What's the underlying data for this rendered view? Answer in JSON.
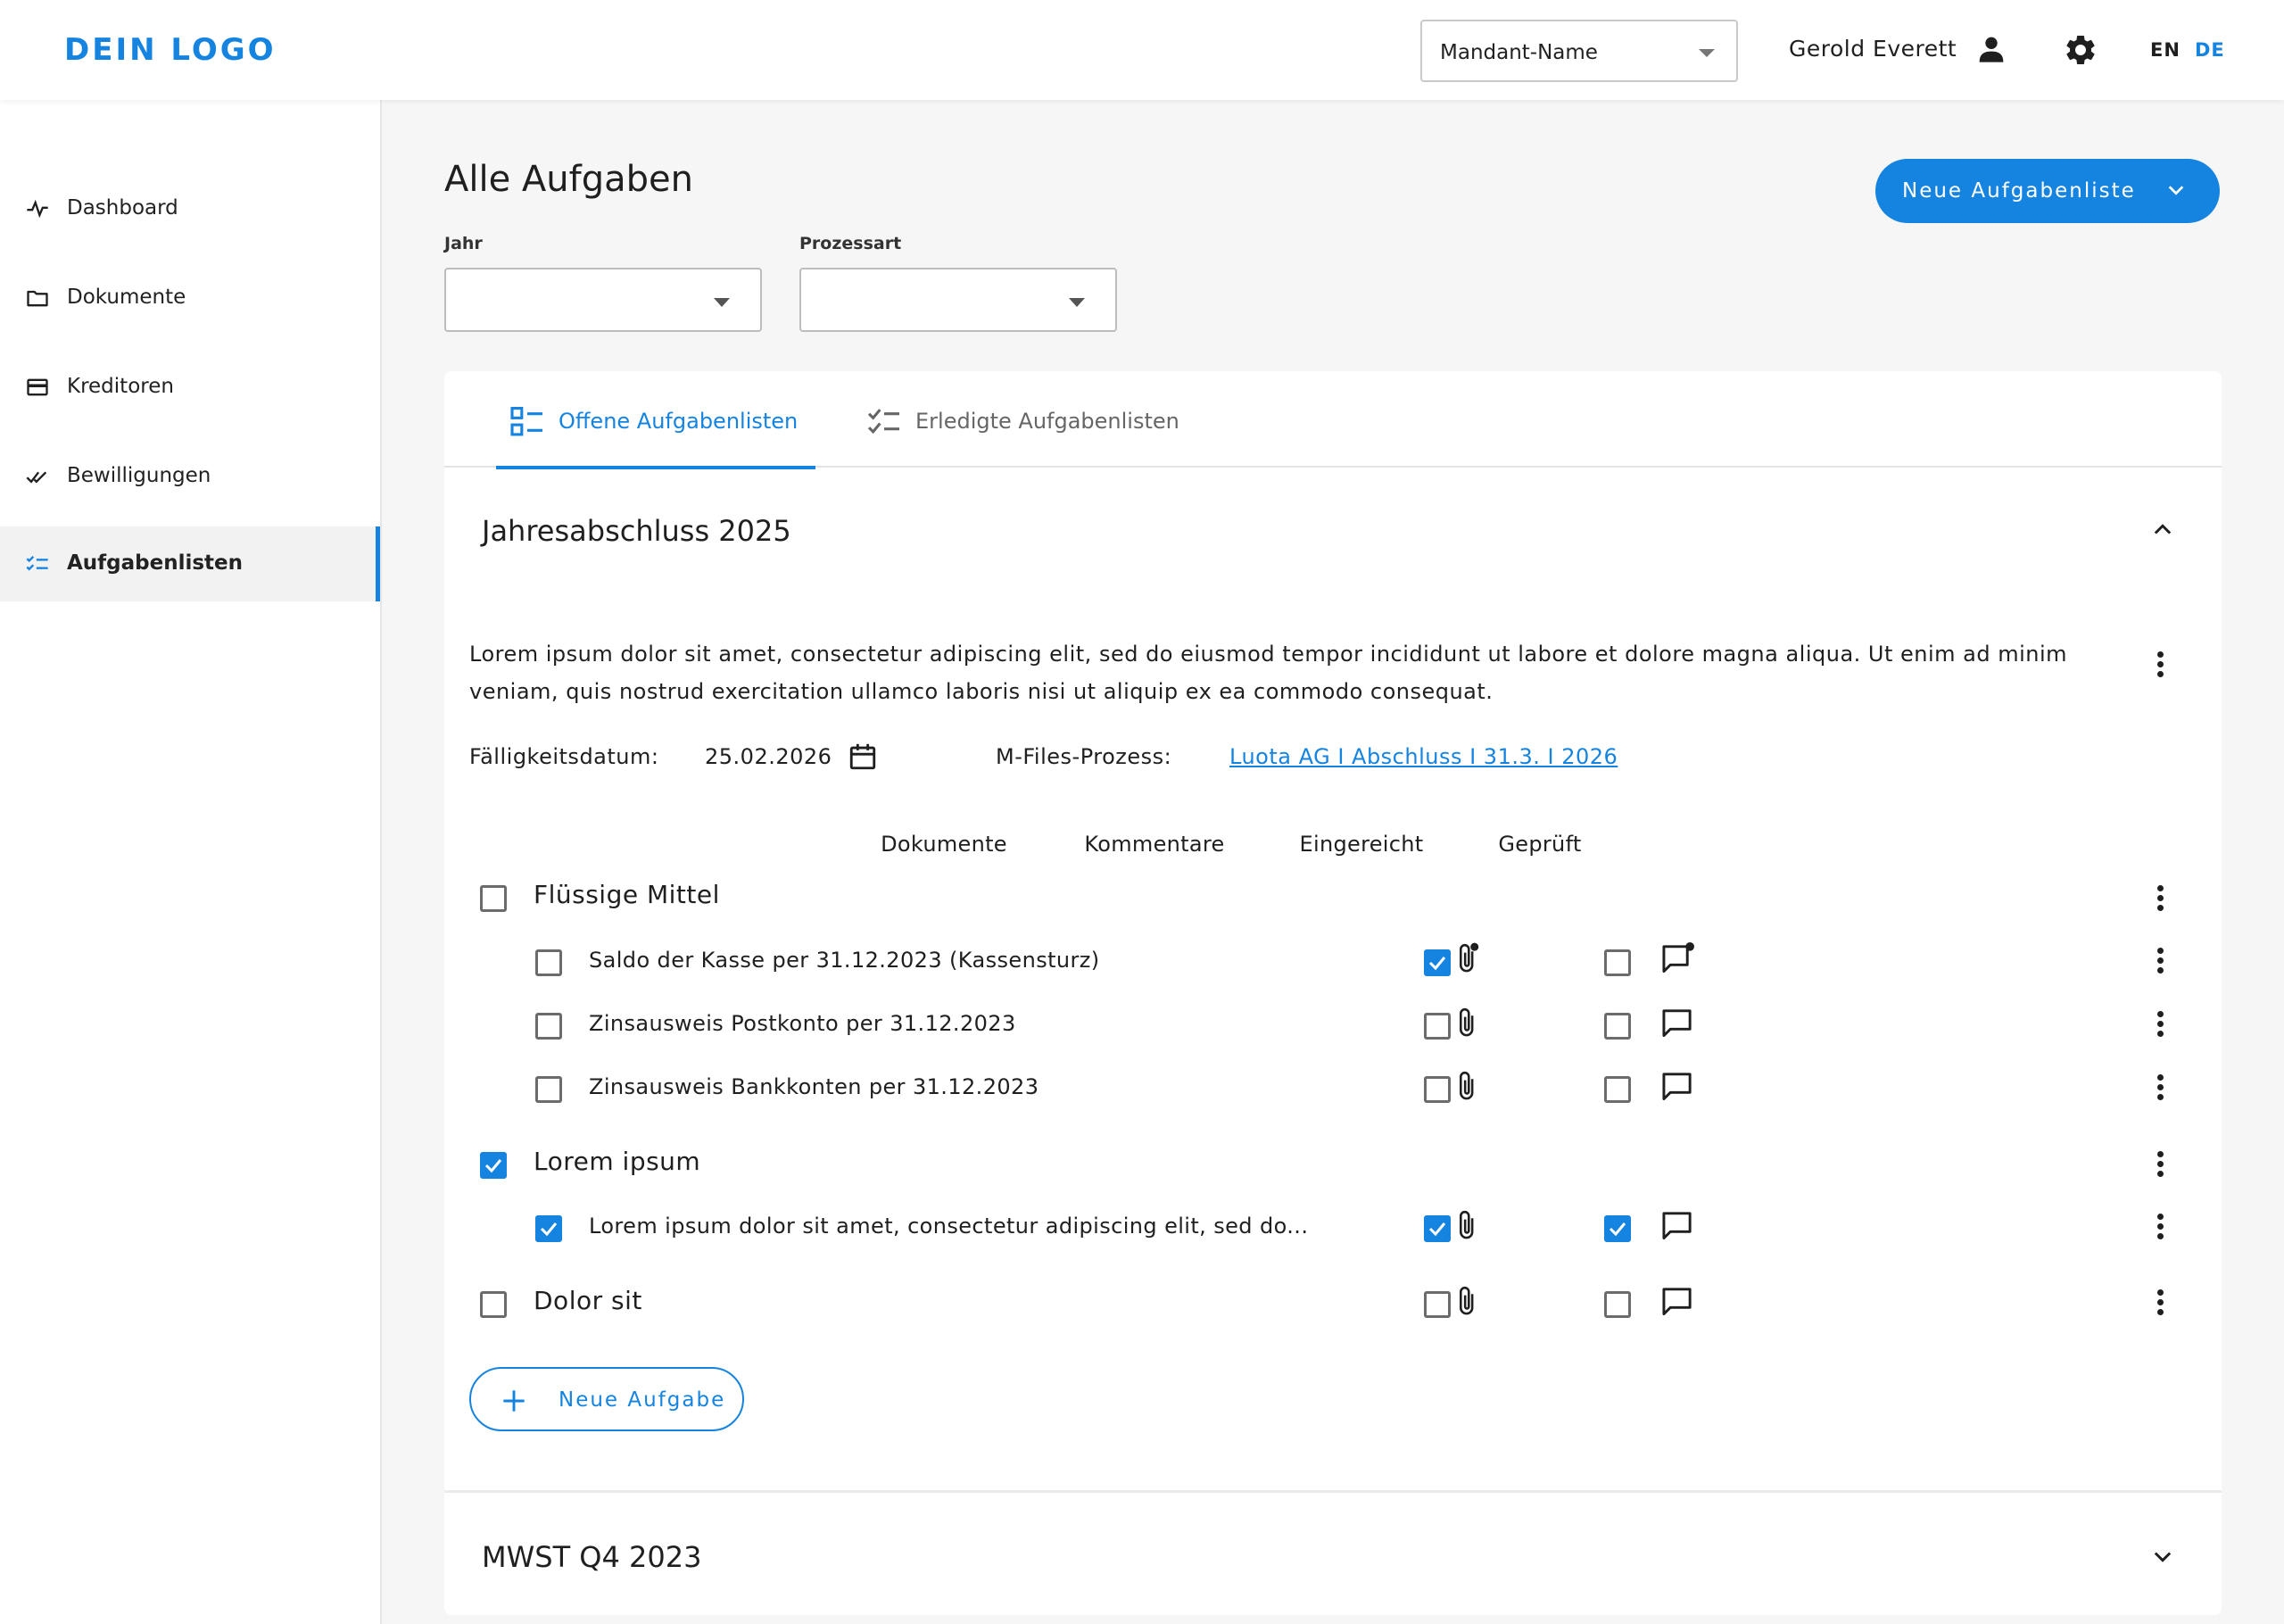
{
  "header": {
    "logo": "DEIN LOGO",
    "tenant_value": "Mandant-Name",
    "user_name": "Gerold Everett",
    "lang_en": "EN",
    "lang_de": "DE"
  },
  "sidebar": {
    "items": [
      {
        "label": "Dashboard",
        "icon": "activity-icon"
      },
      {
        "label": "Dokumente",
        "icon": "folder-icon"
      },
      {
        "label": "Kreditoren",
        "icon": "credit-card-icon"
      },
      {
        "label": "Bewilligungen",
        "icon": "double-check-icon"
      },
      {
        "label": "Aufgabenlisten",
        "icon": "checklist-icon",
        "active": true
      }
    ]
  },
  "main": {
    "title": "Alle Aufgaben",
    "new_list_label": "Neue Aufgabenliste",
    "filters": {
      "year_label": "Jahr",
      "year_value": "",
      "process_label": "Prozessart",
      "process_value": ""
    },
    "tabs": [
      {
        "label": "Offene Aufgabenlisten",
        "active": true
      },
      {
        "label": "Erledigte Aufgabenlisten",
        "active": false
      }
    ],
    "lists": [
      {
        "title": "Jahresabschluss 2025",
        "expanded": true,
        "description": "Lorem ipsum dolor sit amet, consectetur adipiscing elit, sed do eiusmod tempor incididunt ut labore et dolore magna aliqua. Ut enim ad minim veniam, quis nostrud exercitation ullamco laboris nisi ut aliquip ex ea commodo consequat.",
        "due_label": "Fälligkeitsdatum:",
        "due_value": "25.02.2026",
        "mfiles_label": "M-Files-Prozess:",
        "mfiles_link": "Luota AG I Abschluss I 31.3. I 2026",
        "columns": [
          "Dokumente",
          "Kommentare",
          "Eingereicht",
          "Geprüft"
        ],
        "groups": [
          {
            "label": "Flüssige Mittel",
            "checked": false,
            "items": [
              {
                "label": "Saldo der Kasse per 31.12.2023 (Kassensturz)",
                "checked": false,
                "has_documents": true,
                "has_comments": true,
                "submitted": true,
                "reviewed": false
              },
              {
                "label": "Zinsausweis Postkonto per 31.12.2023",
                "checked": false,
                "has_documents": false,
                "has_comments": false,
                "submitted": false,
                "reviewed": false
              },
              {
                "label": "Zinsausweis Bankkonten  per 31.12.2023",
                "checked": false,
                "has_documents": false,
                "has_comments": false,
                "submitted": false,
                "reviewed": false
              }
            ]
          },
          {
            "label": "Lorem ipsum",
            "checked": true,
            "items": [
              {
                "label": "Lorem ipsum dolor sit amet, consectetur adipiscing elit, sed do...",
                "checked": true,
                "has_documents": false,
                "has_comments": false,
                "submitted": true,
                "reviewed": true
              }
            ]
          },
          {
            "label": "Dolor sit",
            "checked": false,
            "submitted": false,
            "reviewed": false,
            "items": []
          }
        ],
        "new_task_label": "Neue Aufgabe"
      },
      {
        "title": "MWST Q4 2023",
        "expanded": false
      }
    ]
  },
  "colors": {
    "accent": "#1583e0",
    "text": "#1f1f1f",
    "background": "#f6f6f6"
  }
}
